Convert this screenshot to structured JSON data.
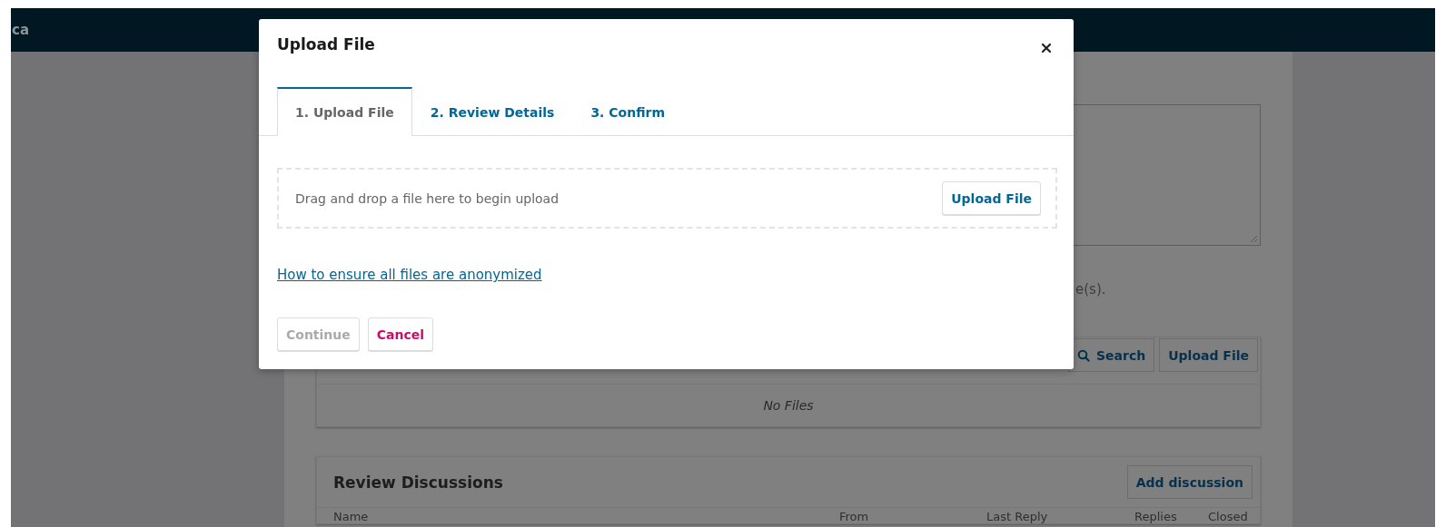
{
  "header": {
    "site_title": "ca"
  },
  "background": {
    "help_text_fragment": "e(s).",
    "files_panel": {
      "buttons": [
        {
          "label": "Search"
        },
        {
          "label": "Upload File"
        }
      ],
      "empty_message": "No Files"
    },
    "discussions_panel": {
      "title": "Review Discussions",
      "button": "Add discussion",
      "columns": [
        "Name",
        "From",
        "Last Reply",
        "Replies",
        "Closed"
      ]
    }
  },
  "modal": {
    "title": "Upload File",
    "tabs": [
      {
        "label": "1. Upload File",
        "selected": true
      },
      {
        "label": "2. Review Details",
        "selected": false
      },
      {
        "label": "3. Confirm",
        "selected": false
      }
    ],
    "dropzone": {
      "message": "Drag and drop a file here to begin upload",
      "button": "Upload File"
    },
    "link": "How to ensure all files are anonymized",
    "buttons": [
      {
        "label": "Continue",
        "kind": "default",
        "disabled": true
      },
      {
        "label": "Cancel",
        "kind": "cancel",
        "disabled": false
      }
    ]
  }
}
